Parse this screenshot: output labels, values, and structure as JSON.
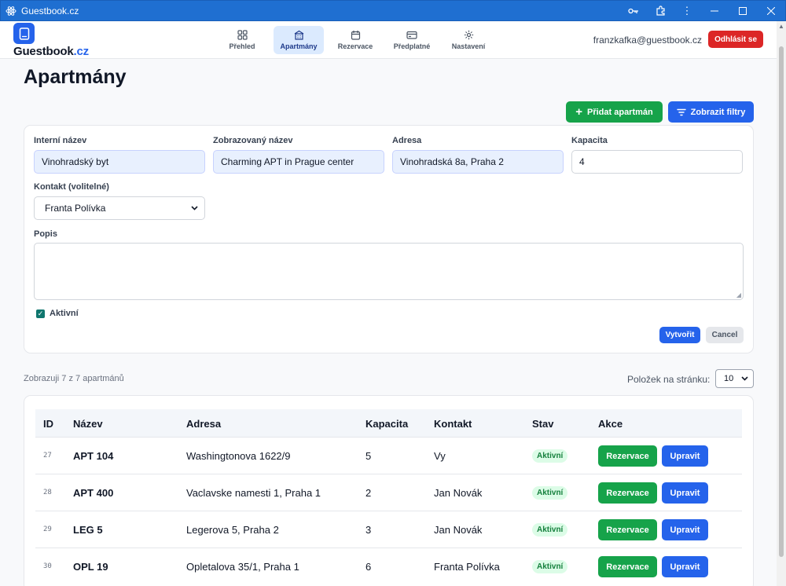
{
  "window": {
    "title": "Guestbook.cz"
  },
  "brand": {
    "name": "Guestbook",
    "tld": ".cz"
  },
  "nav": [
    {
      "label": "Přehled",
      "icon": "grid-icon",
      "active": false
    },
    {
      "label": "Apartmány",
      "icon": "building-icon",
      "active": true
    },
    {
      "label": "Rezervace",
      "icon": "calendar-icon",
      "active": false
    },
    {
      "label": "Předplatné",
      "icon": "credit-card-icon",
      "active": false
    },
    {
      "label": "Nastavení",
      "icon": "gear-icon",
      "active": false
    }
  ],
  "user": {
    "email": "franzkafka@guestbook.cz",
    "logout_label": "Odhlásit se"
  },
  "page": {
    "title": "Apartmány",
    "add_label": "Přidat apartmán",
    "filter_label": "Zobrazit filtry"
  },
  "form": {
    "internal_name": {
      "label": "Interní název",
      "value": "Vinohradský byt"
    },
    "display_name": {
      "label": "Zobrazovaný název",
      "value": "Charming APT in Prague center"
    },
    "address": {
      "label": "Adresa",
      "value": "Vinohradská 8a, Praha 2"
    },
    "capacity": {
      "label": "Kapacita",
      "value": "4"
    },
    "contact": {
      "label": "Kontakt (volitelné)",
      "value": "Franta Polívka"
    },
    "description": {
      "label": "Popis",
      "value": ""
    },
    "active": {
      "label": "Aktivní",
      "checked": true
    },
    "create_label": "Vytvořit",
    "cancel_label": "Cancel"
  },
  "listing": {
    "showing_text": "Zobrazuji 7 z 7 apartmánů",
    "per_page_label": "Položek na stránku:",
    "per_page_value": "10"
  },
  "table": {
    "headers": {
      "id": "ID",
      "name": "Název",
      "address": "Adresa",
      "capacity": "Kapacita",
      "contact": "Kontakt",
      "status": "Stav",
      "actions": "Akce"
    },
    "rows": [
      {
        "id": "27",
        "name": "APT 104",
        "address": "Washingtonova 1622/9",
        "capacity": "5",
        "contact": "Vy",
        "status": "Aktivní",
        "reserve": "Rezervace",
        "edit": "Upravit"
      },
      {
        "id": "28",
        "name": "APT 400",
        "address": "Vaclavske namesti 1, Praha 1",
        "capacity": "2",
        "contact": "Jan Novák",
        "status": "Aktivní",
        "reserve": "Rezervace",
        "edit": "Upravit"
      },
      {
        "id": "29",
        "name": "LEG 5",
        "address": "Legerova 5, Praha 2",
        "capacity": "3",
        "contact": "Jan Novák",
        "status": "Aktivní",
        "reserve": "Rezervace",
        "edit": "Upravit"
      },
      {
        "id": "30",
        "name": "OPL 19",
        "address": "Opletalova 35/1, Praha 1",
        "capacity": "6",
        "contact": "Franta Polívka",
        "status": "Aktivní",
        "reserve": "Rezervace",
        "edit": "Upravit"
      }
    ]
  },
  "colors": {
    "primary": "#2563eb",
    "success": "#16a34a",
    "danger": "#dc2626",
    "titlebar": "#1f6fd1"
  }
}
